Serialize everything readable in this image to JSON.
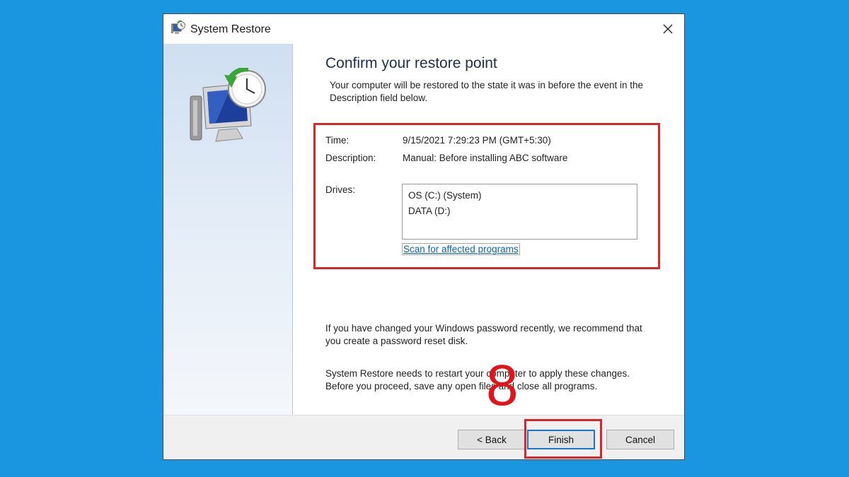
{
  "window": {
    "title": "System Restore"
  },
  "content": {
    "heading": "Confirm your restore point",
    "intro": "Your computer will be restored to the state it was in before the event in the Description field below.",
    "time_label": "Time:",
    "time_value": "9/15/2021 7:29:23 PM (GMT+5:30)",
    "description_label": "Description:",
    "description_value": "Manual: Before installing ABC software",
    "drives_label": "Drives:",
    "drives": [
      "OS (C:) (System)",
      "DATA (D:)"
    ],
    "scan_link": "Scan for affected programs",
    "password_note": "If you have changed your Windows password recently, we recommend that you create a password reset disk.",
    "restart_note": "System Restore needs to restart your computer to apply these changes. Before you proceed, save any open files and close all programs."
  },
  "footer": {
    "back_label": "< Back",
    "finish_label": "Finish",
    "cancel_label": "Cancel"
  },
  "annotation": {
    "step_number": "8",
    "highlight_color": "#d62828"
  },
  "colors": {
    "background": "#1a96e0",
    "link": "#0a63b6",
    "accent": "#1874d0"
  }
}
